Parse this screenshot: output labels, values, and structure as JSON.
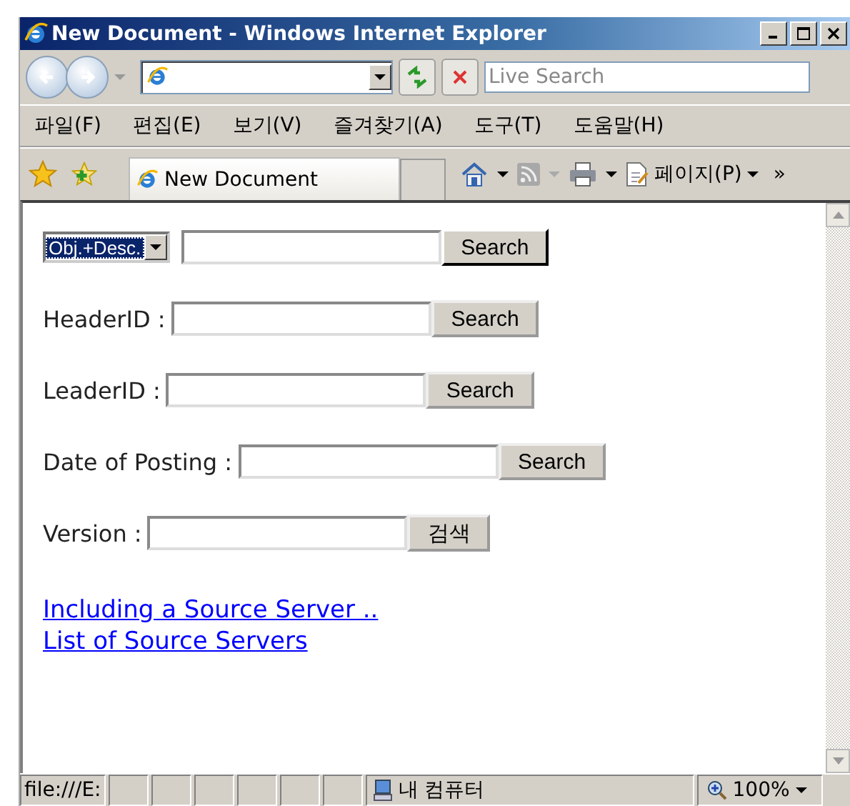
{
  "window": {
    "title": "New Document - Windows Internet Explorer"
  },
  "address_bar": {
    "search_placeholder": "Live Search"
  },
  "menu": [
    "파일(F)",
    "편집(E)",
    "보기(V)",
    "즐겨찾기(A)",
    "도구(T)",
    "도움말(H)"
  ],
  "tab": {
    "title": "New Document"
  },
  "command_bar": {
    "page_menu": "페이지(P)",
    "overflow": "»"
  },
  "content": {
    "filter": {
      "scope": "Obj.+Desc.",
      "button": "Search"
    },
    "fields": [
      {
        "label": "HeaderID :",
        "button": "Search"
      },
      {
        "label": "LeaderID :",
        "button": "Search"
      },
      {
        "label": "Date of Posting :",
        "button": "Search"
      },
      {
        "label": "Version :",
        "button": "검색"
      }
    ],
    "links": [
      "Including a Source Server ..",
      "List of Source Servers"
    ]
  },
  "status_bar": {
    "url": "file:///E:",
    "zone": "내 컴퓨터",
    "zoom": "100%"
  }
}
